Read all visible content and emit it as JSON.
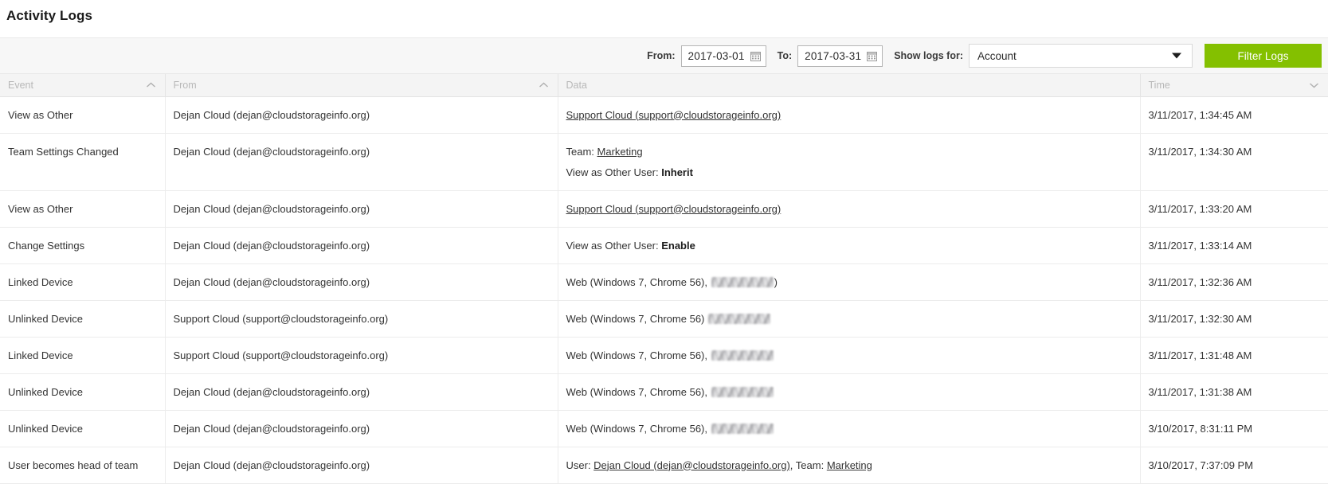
{
  "page_title": "Activity Logs",
  "filter_bar": {
    "from_label": "From:",
    "from_value": "2017-03-01",
    "to_label": "To:",
    "to_value": "2017-03-31",
    "show_logs_label": "Show logs for:",
    "scope_value": "Account",
    "filter_button": "Filter Logs",
    "button_color": "#84c000"
  },
  "table": {
    "columns": [
      {
        "label": "Event",
        "sort": "asc"
      },
      {
        "label": "From",
        "sort": "asc"
      },
      {
        "label": "Data",
        "sort": "none"
      },
      {
        "label": "Time",
        "sort": "desc"
      }
    ],
    "rows": [
      {
        "event": "View as Other",
        "from": "Dejan Cloud (dejan@cloudstorageinfo.org)",
        "data_lines": [
          [
            {
              "type": "link",
              "text": "Support Cloud (support@cloudstorageinfo.org)"
            }
          ]
        ],
        "time": "3/11/2017, 1:34:45 AM"
      },
      {
        "event": "Team Settings Changed",
        "from": "Dejan Cloud (dejan@cloudstorageinfo.org)",
        "data_lines": [
          [
            {
              "type": "text",
              "text": "Team: "
            },
            {
              "type": "link",
              "text": "Marketing"
            }
          ],
          [
            {
              "type": "text",
              "text": "View as Other User: "
            },
            {
              "type": "bold",
              "text": "Inherit"
            }
          ]
        ],
        "time": "3/11/2017, 1:34:30 AM"
      },
      {
        "event": "View as Other",
        "from": "Dejan Cloud (dejan@cloudstorageinfo.org)",
        "data_lines": [
          [
            {
              "type": "link",
              "text": "Support Cloud (support@cloudstorageinfo.org)"
            }
          ]
        ],
        "time": "3/11/2017, 1:33:20 AM"
      },
      {
        "event": "Change Settings",
        "from": "Dejan Cloud (dejan@cloudstorageinfo.org)",
        "data_lines": [
          [
            {
              "type": "text",
              "text": "View as Other User: "
            },
            {
              "type": "bold",
              "text": "Enable"
            }
          ]
        ],
        "time": "3/11/2017, 1:33:14 AM"
      },
      {
        "event": "Linked Device",
        "from": "Dejan Cloud (dejan@cloudstorageinfo.org)",
        "data_lines": [
          [
            {
              "type": "text",
              "text": "Web (Windows 7, Chrome 56), "
            },
            {
              "type": "redacted"
            },
            {
              "type": "text",
              "text": ")"
            }
          ]
        ],
        "time": "3/11/2017, 1:32:36 AM"
      },
      {
        "event": "Unlinked Device",
        "from": "Support Cloud (support@cloudstorageinfo.org)",
        "data_lines": [
          [
            {
              "type": "text",
              "text": "Web (Windows 7, Chrome 56) "
            },
            {
              "type": "redacted"
            }
          ]
        ],
        "time": "3/11/2017, 1:32:30 AM"
      },
      {
        "event": "Linked Device",
        "from": "Support Cloud (support@cloudstorageinfo.org)",
        "data_lines": [
          [
            {
              "type": "text",
              "text": "Web (Windows 7, Chrome 56), "
            },
            {
              "type": "redacted"
            }
          ]
        ],
        "time": "3/11/2017, 1:31:48 AM"
      },
      {
        "event": "Unlinked Device",
        "from": "Dejan Cloud (dejan@cloudstorageinfo.org)",
        "data_lines": [
          [
            {
              "type": "text",
              "text": "Web (Windows 7, Chrome 56), "
            },
            {
              "type": "redacted"
            }
          ]
        ],
        "time": "3/11/2017, 1:31:38 AM"
      },
      {
        "event": "Unlinked Device",
        "from": "Dejan Cloud (dejan@cloudstorageinfo.org)",
        "data_lines": [
          [
            {
              "type": "text",
              "text": "Web (Windows 7, Chrome 56), "
            },
            {
              "type": "redacted"
            }
          ]
        ],
        "time": "3/10/2017, 8:31:11 PM"
      },
      {
        "event": "User becomes head of team",
        "from": "Dejan Cloud (dejan@cloudstorageinfo.org)",
        "data_lines": [
          [
            {
              "type": "text",
              "text": "User: "
            },
            {
              "type": "link",
              "text": "Dejan Cloud (dejan@cloudstorageinfo.org)"
            },
            {
              "type": "text",
              "text": ", Team: "
            },
            {
              "type": "link",
              "text": "Marketing"
            }
          ]
        ],
        "time": "3/10/2017, 7:37:09 PM"
      }
    ]
  }
}
